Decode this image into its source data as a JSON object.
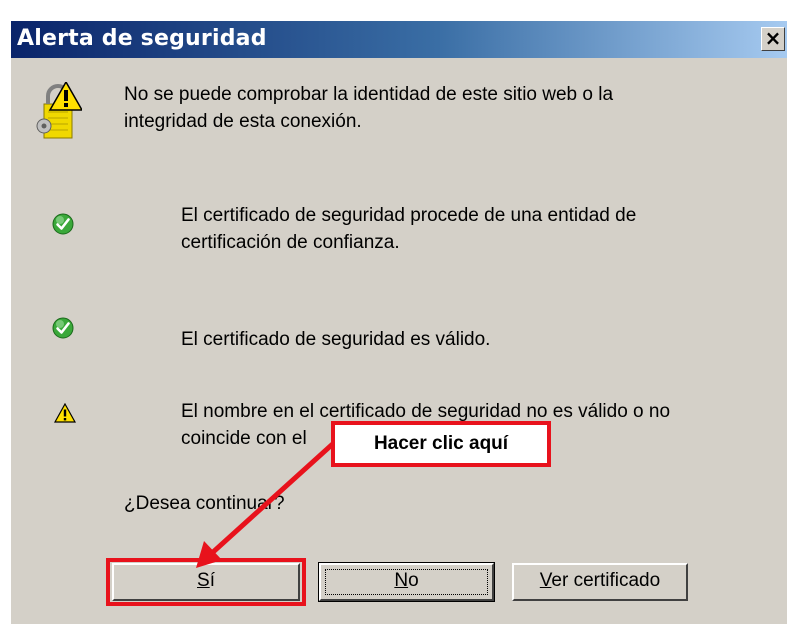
{
  "dialog": {
    "title": "Alerta de seguridad",
    "close_label": "×"
  },
  "intro": {
    "text_line1": "No se puede comprobar la identidad de este sitio web o la",
    "text_line2": "integridad de esta conexión."
  },
  "items": [
    {
      "icon": "check-icon",
      "line1": "El certificado de seguridad procede de una entidad de",
      "line2": "certificación de confianza."
    },
    {
      "icon": "check-icon",
      "line1": "El certificado de seguridad es válido.",
      "line2": ""
    },
    {
      "icon": "warning-icon",
      "line1": "El nombre en el certificado de seguridad no es válido o no",
      "line2": "coincide con el"
    }
  ],
  "question": "¿Desea continuar?",
  "buttons": {
    "yes": "Sí",
    "no": "No",
    "view_certificate": "Ver certificado"
  },
  "annotation": {
    "callout_text": "Hacer clic aquí",
    "color": "#e8121c"
  }
}
